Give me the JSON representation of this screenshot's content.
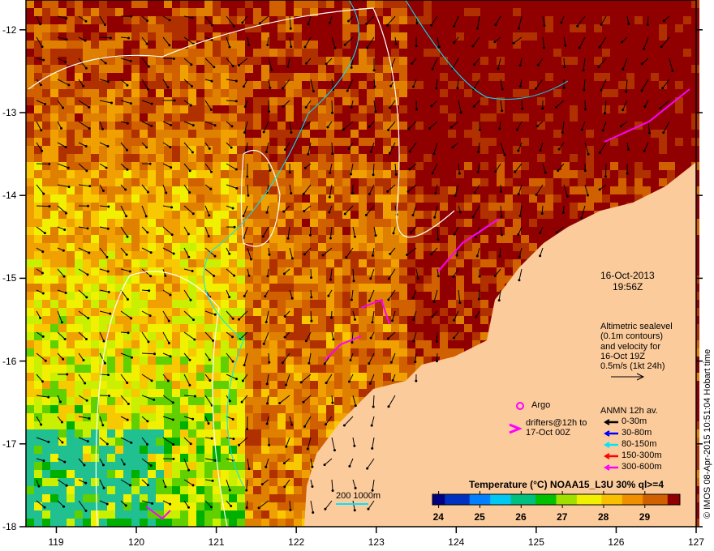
{
  "map": {
    "x_axis": {
      "ticks": [
        "119",
        "120",
        "121",
        "122",
        "123",
        "124",
        "125",
        "126",
        "127"
      ],
      "range": [
        118.62,
        127
      ]
    },
    "y_axis": {
      "ticks": [
        "-12",
        "-13",
        "-14",
        "-15",
        "-16",
        "-17",
        "-18"
      ],
      "range": [
        -18,
        -11.64
      ]
    },
    "date": "16-Oct-2013",
    "time": "19:56Z",
    "altimetry_note": [
      "Altimetric sealevel",
      "(0.1m contours)",
      "and velocity for",
      "16-Oct 19Z",
      "0.5m/s (1kt 24h)"
    ],
    "argo_label": "Argo",
    "drifters_label": [
      "drifters@12h to",
      "17-Oct 00Z"
    ],
    "anmn": {
      "title": "ANMN 12h av.",
      "items": [
        {
          "label": "0-30m",
          "color": "#000000"
        },
        {
          "label": "30-80m",
          "color": "#0000ff"
        },
        {
          "label": "80-150m",
          "color": "#00e5ff"
        },
        {
          "label": "150-300m",
          "color": "#ff0000"
        },
        {
          "label": "300-600m",
          "color": "#ff00ff"
        }
      ]
    },
    "isobath_label": "200  1000m",
    "colorbar": {
      "title": "Temperature (°C) NOAA15_L3U 30% ql>=4",
      "ticks": [
        "24",
        "25",
        "26",
        "27",
        "28",
        "29"
      ],
      "range": [
        23.85,
        29.85
      ]
    },
    "credit": "© IMOS 08-Apr-2015 10:51:04 Hobart time",
    "colors": {
      "land": "#fccb9c",
      "argo": "#ff00ff"
    }
  }
}
